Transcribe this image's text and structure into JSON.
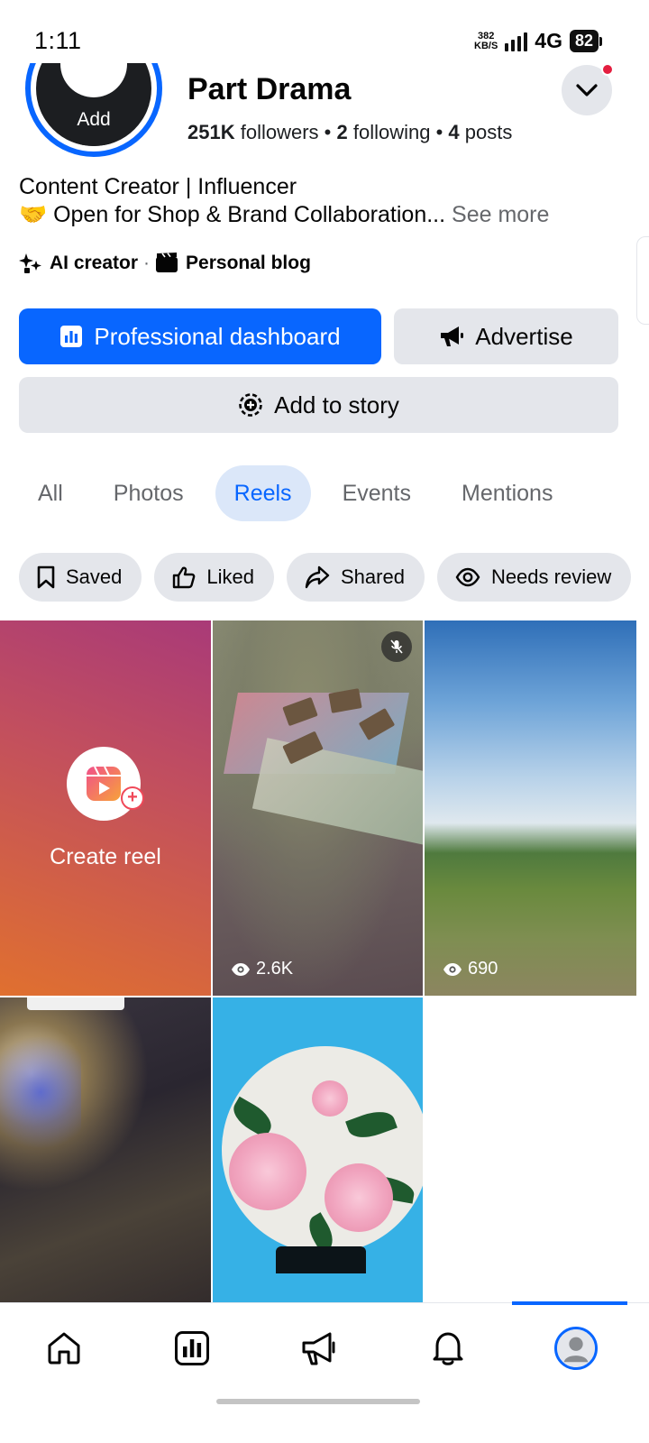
{
  "status_bar": {
    "time": "1:11",
    "net_speed_value": "382",
    "net_speed_unit": "KB/S",
    "network": "4G",
    "battery": "82"
  },
  "profile": {
    "avatar_label": "Add",
    "name": "Part Drama",
    "followers_count": "251K",
    "followers_label": "followers",
    "following_count": "2",
    "following_label": "following",
    "posts_count": "4",
    "posts_label": "posts",
    "bio_line1": "Content Creator | Influencer",
    "bio_line2": "🤝 Open for Shop & Brand Collaboration...",
    "see_more": "See more",
    "categories": [
      "AI creator",
      "Personal blog"
    ],
    "category_separator": "·",
    "stats_separator": "•"
  },
  "actions": {
    "dashboard_label": "Professional dashboard",
    "advertise_label": "Advertise",
    "add_story_label": "Add to story"
  },
  "tabs": [
    {
      "label": "All",
      "active": false
    },
    {
      "label": "Photos",
      "active": false
    },
    {
      "label": "Reels",
      "active": true
    },
    {
      "label": "Events",
      "active": false
    },
    {
      "label": "Mentions",
      "active": false
    }
  ],
  "filters": [
    {
      "label": "Saved",
      "icon": "bookmark-icon"
    },
    {
      "label": "Liked",
      "icon": "thumbs-up-icon"
    },
    {
      "label": "Shared",
      "icon": "share-icon"
    },
    {
      "label": "Needs review",
      "icon": "eye-icon"
    }
  ],
  "reels": {
    "create_label": "Create reel",
    "items": [
      {
        "views": "2.6K",
        "muted": true
      },
      {
        "views": "690"
      },
      {
        "views": ""
      },
      {
        "views": ""
      }
    ]
  },
  "bottom_nav": [
    {
      "icon": "home-icon"
    },
    {
      "icon": "dashboard-icon"
    },
    {
      "icon": "megaphone-icon"
    },
    {
      "icon": "bell-icon"
    },
    {
      "icon": "profile-avatar-icon",
      "active": true
    }
  ],
  "colors": {
    "accent": "#0866ff",
    "secondary_button": "#e4e6eb",
    "active_tab_bg": "#dbe7f9",
    "notification_dot": "#e41e3f"
  }
}
